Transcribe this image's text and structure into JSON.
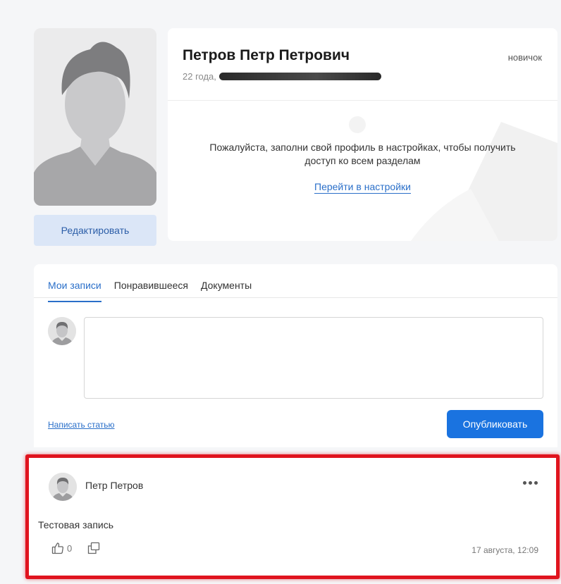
{
  "profile": {
    "name": "Петров Петр Петрович",
    "age_text": "22 года,",
    "rank": "новичок",
    "edit_label": "Редактировать",
    "notice": "Пожалуйста, заполни свой профиль в настройках, чтобы получить доступ ко всем разделам",
    "settings_link": "Перейти в настройки"
  },
  "feed": {
    "tabs": [
      {
        "label": "Мои записи",
        "active": true
      },
      {
        "label": "Понравившееся",
        "active": false
      },
      {
        "label": "Документы",
        "active": false
      }
    ],
    "write_article": "Написать статью",
    "publish_label": "Опубликовать"
  },
  "post": {
    "author": "Петр Петров",
    "text": "Тестовая запись",
    "likes": "0",
    "date": "17 августа, 12:09"
  },
  "colors": {
    "accent": "#1a73e0",
    "link": "#2a6fc9",
    "highlight": "#e0141e"
  },
  "icons": [
    "avatar-placeholder-icon",
    "thumbs-up-icon",
    "repost-icon",
    "more-dots-icon"
  ]
}
